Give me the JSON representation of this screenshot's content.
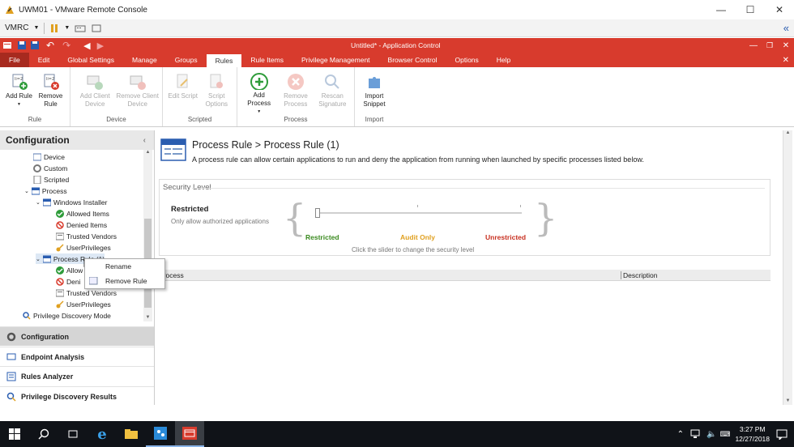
{
  "vmrc": {
    "title": "UWM01 - VMware Remote Console",
    "menu_label": "VMRC",
    "minimize": "—",
    "maximize": "☐",
    "close": "✕"
  },
  "app": {
    "title": "Untitled* - Application Control",
    "menu": [
      "File",
      "Edit",
      "Global Settings",
      "Manage",
      "Groups",
      "Rules",
      "Rule Items",
      "Privilege Management",
      "Browser Control",
      "Options",
      "Help"
    ],
    "active_menu_index": 5
  },
  "ribbon": {
    "groups": [
      {
        "label": "Rule",
        "buttons": [
          {
            "label": "Add Rule",
            "enabled": true,
            "dropdown": true
          },
          {
            "label": "Remove Rule",
            "enabled": true
          }
        ]
      },
      {
        "label": "Device",
        "buttons": [
          {
            "label": "Add Client Device",
            "enabled": false,
            "dropdown": true
          },
          {
            "label": "Remove Client Device",
            "enabled": false
          }
        ]
      },
      {
        "label": "Scripted",
        "buttons": [
          {
            "label": "Edit Script",
            "enabled": false
          },
          {
            "label": "Script Options",
            "enabled": false
          }
        ]
      },
      {
        "label": "Process",
        "buttons": [
          {
            "label": "Add Process",
            "enabled": true,
            "dropdown": true
          },
          {
            "label": "Remove Process",
            "enabled": false
          },
          {
            "label": "Rescan Signature",
            "enabled": false
          }
        ]
      },
      {
        "label": "Import",
        "buttons": [
          {
            "label": "Import Snippet",
            "enabled": true
          }
        ]
      }
    ]
  },
  "sidebar": {
    "title": "Configuration",
    "tree": [
      {
        "label": "Device",
        "icon": "device-icon"
      },
      {
        "label": "Custom",
        "icon": "custom-icon"
      },
      {
        "label": "Scripted",
        "icon": "scripted-icon"
      },
      {
        "label": "Process",
        "icon": "process-icon"
      },
      {
        "label": "Windows Installer",
        "icon": "rule-icon"
      },
      {
        "label": "Allowed Items",
        "icon": "allowed-icon"
      },
      {
        "label": "Denied Items",
        "icon": "denied-icon"
      },
      {
        "label": "Trusted Vendors",
        "icon": "vendors-icon"
      },
      {
        "label": "UserPrivileges",
        "icon": "privileges-icon"
      },
      {
        "label": "Process Rule (1)",
        "icon": "rule-icon"
      },
      {
        "label": "Allow",
        "icon": "allowed-icon"
      },
      {
        "label": "Deni",
        "icon": "denied-icon"
      },
      {
        "label": "Trusted Vendors",
        "icon": "vendors-icon"
      },
      {
        "label": "UserPrivileges",
        "icon": "privileges-icon"
      },
      {
        "label": "Privilege Discovery Mode",
        "icon": "discovery-icon"
      }
    ],
    "nav": [
      "Configuration",
      "Endpoint Analysis",
      "Rules Analyzer",
      "Privilege Discovery Results"
    ]
  },
  "context_menu": {
    "items": [
      "Rename",
      "Remove Rule"
    ]
  },
  "main": {
    "breadcrumb": "Process Rule > Process Rule (1)",
    "description": "A process rule can allow certain applications to run and deny the application from running when launched by specific processes listed below.",
    "security": {
      "title": "Security Level",
      "level_name": "Restricted",
      "level_desc": "Only allow authorized applications",
      "stops": [
        {
          "label": "Restricted",
          "color": "#3a8a1f"
        },
        {
          "label": "Audit Only",
          "color": "#e0a020"
        },
        {
          "label": "Unrestricted",
          "color": "#c83020"
        }
      ],
      "selected_stop": 0,
      "hint": "Click the slider to change the security level"
    },
    "table": {
      "columns": [
        "Process",
        "Description"
      ]
    }
  },
  "taskbar": {
    "time": "3:27 PM",
    "date": "12/27/2018"
  }
}
